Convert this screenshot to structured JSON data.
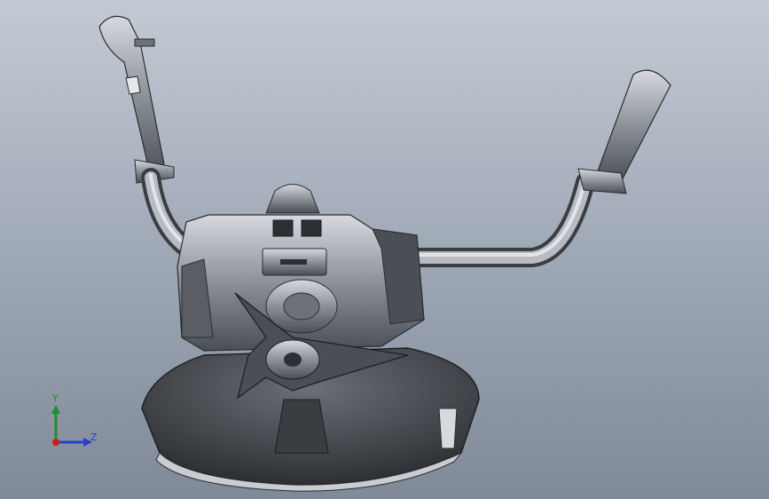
{
  "viewport": {
    "background_top": "#c3cad3",
    "background_bottom": "#7f8998",
    "model": "brush-cutter-assembly"
  },
  "triad": {
    "y_label": "Y",
    "z_label": "Z",
    "colors": {
      "y": "#1f8f2a",
      "z": "#2a40c8",
      "x": "#c82020"
    }
  }
}
